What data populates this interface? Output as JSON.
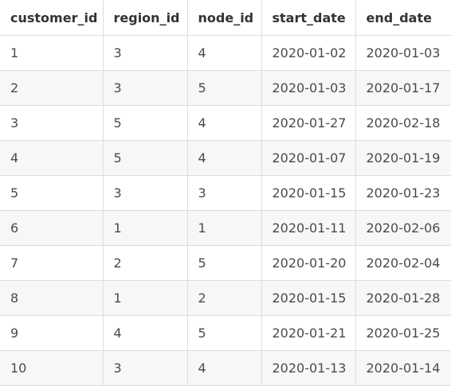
{
  "table": {
    "columns": [
      "customer_id",
      "region_id",
      "node_id",
      "start_date",
      "end_date"
    ],
    "rows": [
      [
        "1",
        "3",
        "4",
        "2020-01-02",
        "2020-01-03"
      ],
      [
        "2",
        "3",
        "5",
        "2020-01-03",
        "2020-01-17"
      ],
      [
        "3",
        "5",
        "4",
        "2020-01-27",
        "2020-02-18"
      ],
      [
        "4",
        "5",
        "4",
        "2020-01-07",
        "2020-01-19"
      ],
      [
        "5",
        "3",
        "3",
        "2020-01-15",
        "2020-01-23"
      ],
      [
        "6",
        "1",
        "1",
        "2020-01-11",
        "2020-02-06"
      ],
      [
        "7",
        "2",
        "5",
        "2020-01-20",
        "2020-02-04"
      ],
      [
        "8",
        "1",
        "2",
        "2020-01-15",
        "2020-01-28"
      ],
      [
        "9",
        "4",
        "5",
        "2020-01-21",
        "2020-01-25"
      ],
      [
        "10",
        "3",
        "4",
        "2020-01-13",
        "2020-01-14"
      ]
    ]
  }
}
